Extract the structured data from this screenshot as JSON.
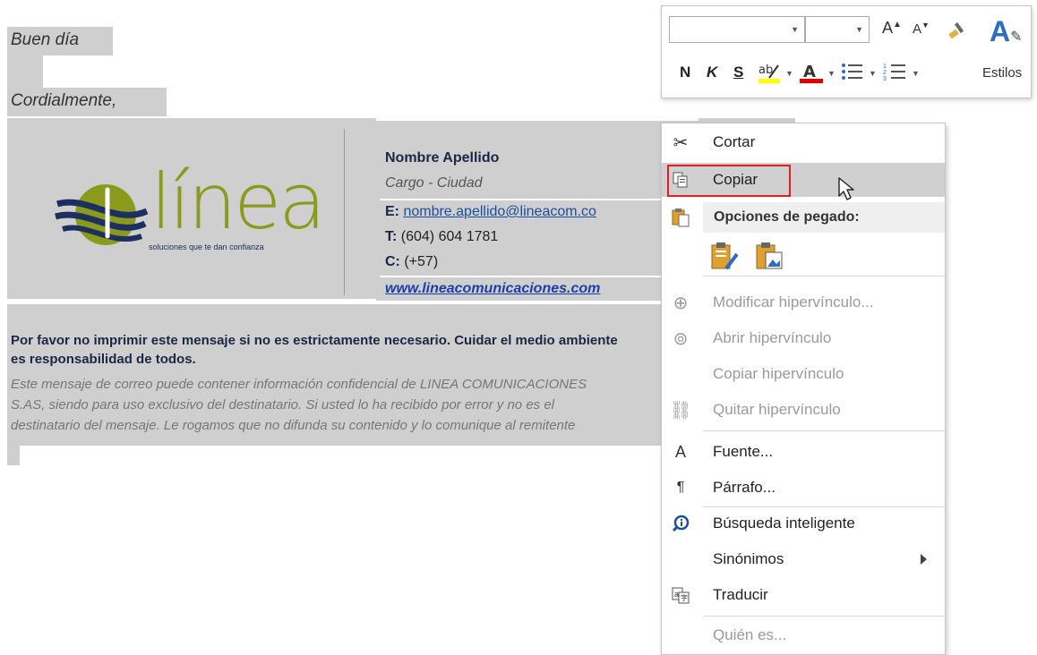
{
  "document": {
    "greeting": "Buen día",
    "closing": "Cordialmente,",
    "signature": {
      "logo_word": "línea",
      "logo_tagline": "soluciones que te dan confianza",
      "name": "Nombre Apellido",
      "role": "Cargo - Ciudad",
      "email_label": "E:",
      "email": "nombre.apellido@lineacom.co",
      "phone_label": "T:",
      "phone": "(604) 604 1781",
      "cell_label": "C:",
      "cell": "(+57)",
      "website": "www.lineacomunicaciones.com"
    },
    "disclaimer": {
      "line1": "Por favor no imprimir este mensaje si no es estrictamente necesario. Cuidar el medio ambiente",
      "line2": "es responsabilidad de todos.",
      "legal1": "Este mensaje de correo puede contener información confidencial de LINEA COMUNICACIONES",
      "legal2": "S.AS, siendo para uso exclusivo del destinatario. Si usted lo ha recibido por error y no es el",
      "legal3": "destinatario del mensaje. Le rogamos que no difunda su contenido y lo comunique al remitente"
    }
  },
  "mini_toolbar": {
    "font_name": "",
    "font_size": "",
    "bold": "N",
    "italic": "K",
    "underline": "S",
    "font_color_letter": "A",
    "styles_label": "Estilos",
    "highlight_color": "#ffff00",
    "font_color": "#e00000"
  },
  "context_menu": {
    "items": [
      {
        "label": "Cortar",
        "icon": "scissors-icon",
        "enabled": true
      },
      {
        "label": "Copiar",
        "icon": "copy-icon",
        "enabled": true,
        "hovered": true,
        "highlighted": true
      },
      {
        "label": "Opciones de pegado:",
        "icon": "paste-icon",
        "enabled": true,
        "header": true
      },
      {
        "label": "Modificar hipervínculo...",
        "icon": "edit-link-icon",
        "enabled": false
      },
      {
        "label": "Abrir hipervínculo",
        "icon": "open-link-icon",
        "enabled": false
      },
      {
        "label": "Copiar hipervínculo",
        "icon": "",
        "enabled": false
      },
      {
        "label": "Quitar hipervínculo",
        "icon": "remove-link-icon",
        "enabled": false
      },
      {
        "label": "Fuente...",
        "icon": "font-icon",
        "enabled": true
      },
      {
        "label": "Párrafo...",
        "icon": "paragraph-icon",
        "enabled": true
      },
      {
        "label": "Búsqueda inteligente",
        "icon": "smart-lookup-icon",
        "enabled": true
      },
      {
        "label": "Sinónimos",
        "icon": "",
        "enabled": true,
        "submenu": true
      },
      {
        "label": "Traducir",
        "icon": "translate-icon",
        "enabled": true
      },
      {
        "label": "Quién es...",
        "icon": "",
        "enabled": false
      }
    ],
    "highlight_color": "#e02020",
    "hover_color": "#d0d0d0"
  }
}
